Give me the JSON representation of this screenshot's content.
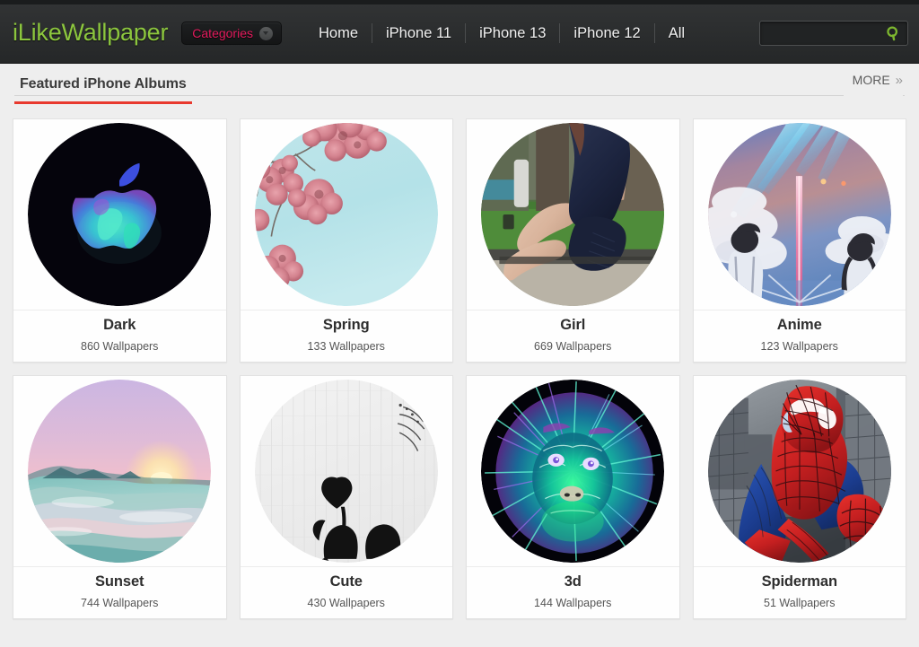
{
  "header": {
    "logo": "iLikeWallpaper",
    "logo_color": "#8cc63e",
    "categories_label": "Categories",
    "categories_color": "#e31b5d",
    "caret_icon": "chevron-down-icon",
    "nav": [
      {
        "label": "Home"
      },
      {
        "label": "iPhone 11"
      },
      {
        "label": "iPhone 13"
      },
      {
        "label": "iPhone 12"
      },
      {
        "label": "All"
      }
    ],
    "search": {
      "value": "",
      "placeholder": "",
      "icon": "search-icon",
      "icon_color": "#8cc63e"
    },
    "background_color": "#2b2d2e"
  },
  "section": {
    "title": "Featured iPhone Albums",
    "accent_color": "#e8392e",
    "more_label": "MORE",
    "more_chevron": "»"
  },
  "albums": [
    {
      "title": "Dark",
      "count": "860 Wallpapers",
      "art": "dark-apple-logo-thumbnail"
    },
    {
      "title": "Spring",
      "count": "133 Wallpapers",
      "art": "cherry-blossom-thumbnail"
    },
    {
      "title": "Girl",
      "count": "669 Wallpapers",
      "art": "girl-sitting-thumbnail"
    },
    {
      "title": "Anime",
      "count": "123 Wallpapers",
      "art": "anime-comet-sky-thumbnail"
    },
    {
      "title": "Sunset",
      "count": "744 Wallpapers",
      "art": "sunset-clouds-thumbnail"
    },
    {
      "title": "Cute",
      "count": "430 Wallpapers",
      "art": "heart-balloon-silhouette-thumbnail"
    },
    {
      "title": "3d",
      "count": "144 Wallpapers",
      "art": "neon-lion-thumbnail"
    },
    {
      "title": "Spiderman",
      "count": "51 Wallpapers",
      "art": "spiderman-thumbnail"
    }
  ]
}
